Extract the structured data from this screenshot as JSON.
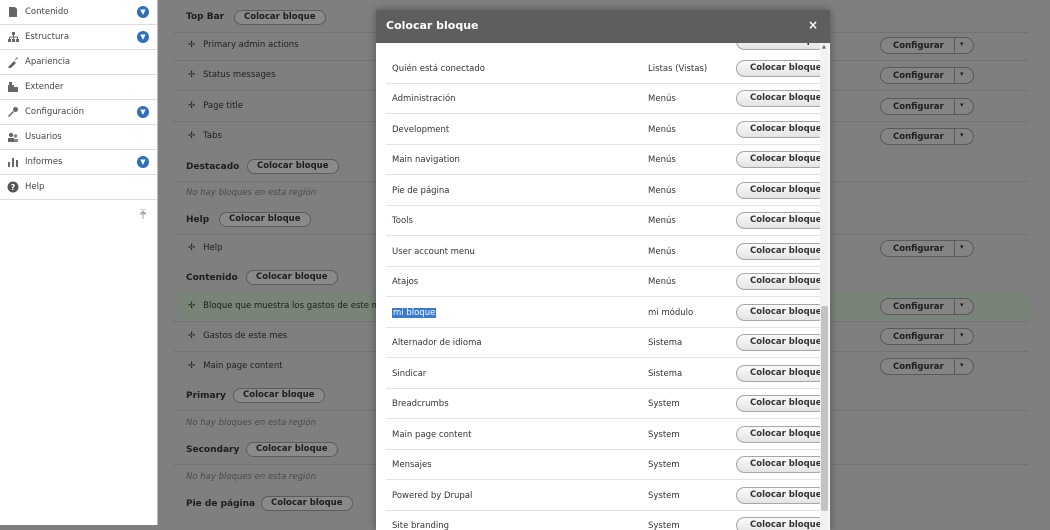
{
  "sidebar": {
    "items": [
      {
        "label": "Contenido",
        "icon": "content-icon",
        "expandable": true
      },
      {
        "label": "Estructura",
        "icon": "structure-icon",
        "expandable": true
      },
      {
        "label": "Apariencia",
        "icon": "appearance-icon",
        "expandable": false
      },
      {
        "label": "Extender",
        "icon": "extend-icon",
        "expandable": false
      },
      {
        "label": "Configuración",
        "icon": "wrench-icon",
        "expandable": true
      },
      {
        "label": "Usuarios",
        "icon": "users-icon",
        "expandable": false
      },
      {
        "label": "Informes",
        "icon": "reports-icon",
        "expandable": true
      },
      {
        "label": "Help",
        "icon": "help-icon",
        "expandable": false
      }
    ]
  },
  "layout": {
    "place_block_label": "Colocar bloque",
    "configure_label": "Configurar",
    "empty_region_text": "No hay bloques en esta región",
    "regions": {
      "top_bar": "Top Bar",
      "destacado": "Destacado",
      "help": "Help",
      "contenido": "Contenido",
      "primary": "Primary",
      "secondary": "Secondary",
      "pie": "Pie de página"
    },
    "blocks": {
      "primary_admin_actions": "Primary admin actions",
      "status_messages": "Status messages",
      "page_title": "Page title",
      "tabs": "Tabs",
      "help": "Help",
      "bloque_gastos": "Bloque que muestra los gastos de este m",
      "gastos_mes": "Gastos de este mes",
      "main_page_content": "Main page content"
    }
  },
  "modal": {
    "title": "Colocar bloque",
    "close_symbol": "×",
    "button_label": "Colocar bloque",
    "rows": [
      {
        "name": "Quién está conectado",
        "category": "Listas (Vistas)"
      },
      {
        "name": "Administración",
        "category": "Menús"
      },
      {
        "name": "Development",
        "category": "Menús"
      },
      {
        "name": "Main navigation",
        "category": "Menús"
      },
      {
        "name": "Pie de página",
        "category": "Menús"
      },
      {
        "name": "Tools",
        "category": "Menús"
      },
      {
        "name": "User account menu",
        "category": "Menús"
      },
      {
        "name": "Atajos",
        "category": "Menús"
      },
      {
        "name": "mi bloque",
        "category": "mi módulo",
        "selected": true
      },
      {
        "name": "Alternador de idioma",
        "category": "Sistema"
      },
      {
        "name": "Sindicar",
        "category": "Sistema"
      },
      {
        "name": "Breadcrumbs",
        "category": "System"
      },
      {
        "name": "Main page content",
        "category": "System"
      },
      {
        "name": "Mensajes",
        "category": "System"
      },
      {
        "name": "Powered by Drupal",
        "category": "System"
      },
      {
        "name": "Site branding",
        "category": "System"
      }
    ]
  },
  "colors": {
    "accent": "#2f6ebb",
    "selection": "#3b7bd4",
    "modal_header": "#5e5e5e"
  }
}
